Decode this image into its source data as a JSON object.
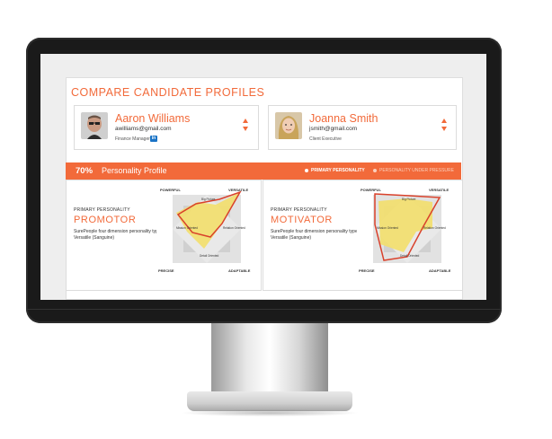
{
  "page": {
    "title": "COMPARE CANDIDATE PROFILES"
  },
  "candidates": [
    {
      "name": "Aaron Williams",
      "email": "awilliams@gmail.com",
      "role": "Finance Manager",
      "linkedin": "in"
    },
    {
      "name": "Joanna Smith",
      "email": "jsmith@gmail.com",
      "role": "Client Executive"
    }
  ],
  "profile_bar": {
    "percent": "70%",
    "title": "Personality Profile",
    "legend_primary": "PRIMARY PERSONALITY",
    "legend_pressure": "PERSONALITY UNDER PRESSURE"
  },
  "profiles": [
    {
      "label": "PRIMARY PERSONALITY",
      "type": "PROMOTOR",
      "description": "SurePeople four dimension personality type: Versatile (Sanguine)",
      "axes": {
        "top_left": "POWERFUL",
        "top_right": "VERSATILE",
        "bottom_left": "PRECISE",
        "bottom_right": "ADAPTABLE",
        "top": "Big Picture",
        "right": "Relation Oriented",
        "bottom": "Detail Oriented",
        "left": "Mission Oriented"
      }
    },
    {
      "label": "PRIMARY PERSONALITY",
      "type": "MOTIVATOR",
      "description": "SurePeople four dimension personality type: Versatile (Sanguine)",
      "axes": {
        "top_left": "POWERFUL",
        "top_right": "VERSATILE",
        "bottom_left": "PRECISE",
        "bottom_right": "ADAPTABLE",
        "top": "Big Picture",
        "right": "Relation Oriented",
        "bottom": "Detail Oriented",
        "left": "Mission Oriented"
      }
    }
  ],
  "colors": {
    "accent": "#f26a3a",
    "primary_fill": "#f2de6e",
    "pressure_outline": "#d9412b",
    "bezel": "#1a1a1a"
  }
}
